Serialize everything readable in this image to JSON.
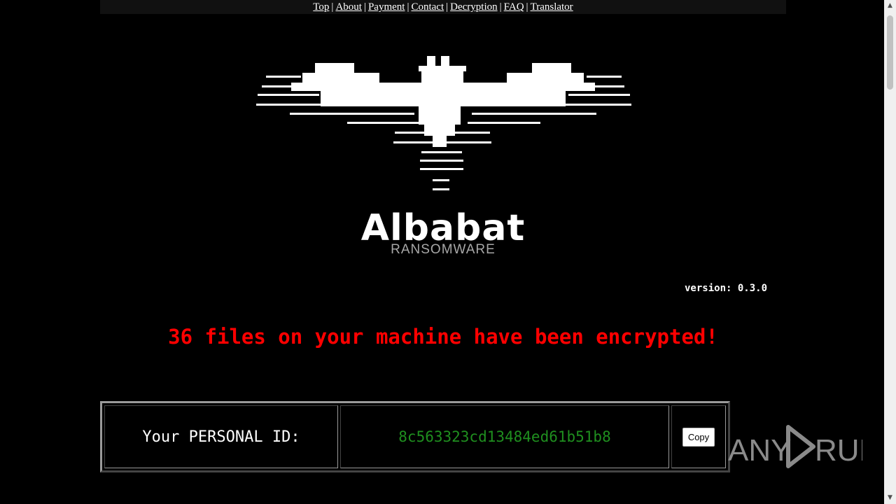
{
  "nav": {
    "items": [
      {
        "label": "Top"
      },
      {
        "label": "About"
      },
      {
        "label": "Payment"
      },
      {
        "label": "Contact"
      },
      {
        "label": "Decryption"
      },
      {
        "label": "FAQ"
      },
      {
        "label": "Translator"
      }
    ],
    "separator": "|"
  },
  "logo": {
    "icon": "bat-icon",
    "title": "Albabat",
    "subtitle": "RANSOMWARE"
  },
  "version_text": "version: 0.3.0",
  "headline": "36 files on your machine have been encrypted!",
  "personal_id": {
    "label": "Your PERSONAL ID:",
    "value": "8c563323cd13484ed61b51b8",
    "copy_label": "Copy"
  },
  "watermark": {
    "text_left": "ANY",
    "text_right": "RUN",
    "icon": "play-icon"
  },
  "scrollbar": {
    "up_icon": "▲",
    "down_icon": "▼"
  },
  "colors": {
    "background": "#000000",
    "headline": "#ff0000",
    "id_value": "#1f8f1f",
    "subtitle": "#a8a8a8"
  }
}
